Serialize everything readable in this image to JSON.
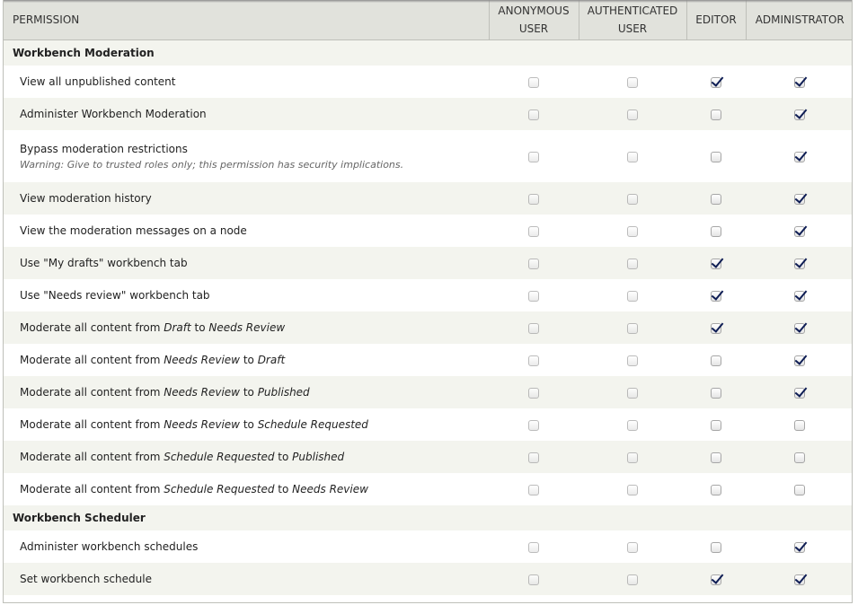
{
  "columns": {
    "permission": "Permission",
    "anonymous": "Anonymous user",
    "authenticated": "Authenticated user",
    "editor": "Editor",
    "administrator": "Administrator"
  },
  "sections": [
    {
      "name": "Workbench Moderation",
      "rows": [
        {
          "parts": [
            "View all unpublished content"
          ],
          "perms": [
            false,
            false,
            true,
            true
          ]
        },
        {
          "parts": [
            "Administer Workbench Moderation"
          ],
          "perms": [
            false,
            false,
            false,
            true
          ]
        },
        {
          "parts": [
            "Bypass moderation restrictions"
          ],
          "desc": "Warning: Give to trusted roles only; this permission has security implications.",
          "perms": [
            false,
            false,
            false,
            true
          ]
        },
        {
          "parts": [
            "View moderation history"
          ],
          "perms": [
            false,
            false,
            false,
            true
          ]
        },
        {
          "parts": [
            "View the moderation messages on a node"
          ],
          "perms": [
            false,
            false,
            false,
            true
          ]
        },
        {
          "parts": [
            "Use \"My drafts\" workbench tab"
          ],
          "perms": [
            false,
            false,
            true,
            true
          ]
        },
        {
          "parts": [
            "Use \"Needs review\" workbench tab"
          ],
          "perms": [
            false,
            false,
            true,
            true
          ]
        },
        {
          "parts": [
            "Moderate all content from ",
            "Draft",
            " to ",
            "Needs Review"
          ],
          "perms": [
            false,
            false,
            true,
            true
          ]
        },
        {
          "parts": [
            "Moderate all content from ",
            "Needs Review",
            " to ",
            "Draft"
          ],
          "perms": [
            false,
            false,
            false,
            true
          ]
        },
        {
          "parts": [
            "Moderate all content from ",
            "Needs Review",
            " to ",
            "Published"
          ],
          "perms": [
            false,
            false,
            false,
            true
          ]
        },
        {
          "parts": [
            "Moderate all content from ",
            "Needs Review",
            " to ",
            "Schedule Requested"
          ],
          "perms": [
            false,
            false,
            false,
            false
          ]
        },
        {
          "parts": [
            "Moderate all content from ",
            "Schedule Requested",
            " to ",
            "Published"
          ],
          "perms": [
            false,
            false,
            false,
            false
          ]
        },
        {
          "parts": [
            "Moderate all content from ",
            "Schedule Requested",
            " to ",
            "Needs Review"
          ],
          "perms": [
            false,
            false,
            false,
            false
          ]
        }
      ]
    },
    {
      "name": "Workbench Scheduler",
      "rows": [
        {
          "parts": [
            "Administer workbench schedules"
          ],
          "perms": [
            false,
            false,
            false,
            true
          ]
        },
        {
          "parts": [
            "Set workbench schedule"
          ],
          "perms": [
            false,
            false,
            true,
            true
          ]
        }
      ]
    }
  ],
  "colors": {
    "header_bg": "#e1e2dc",
    "stripe_bg": "#f3f4ee",
    "border": "#bebfb9",
    "check": "#0e1d54"
  }
}
